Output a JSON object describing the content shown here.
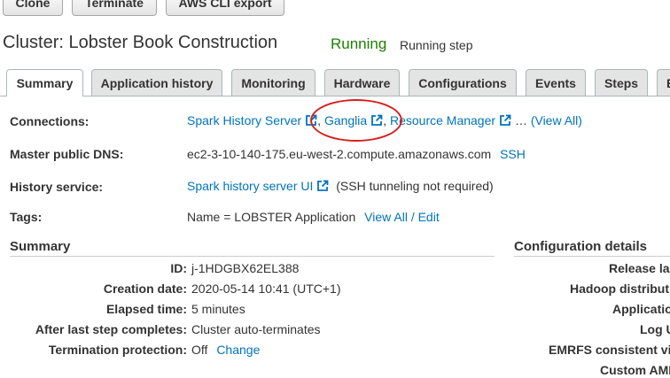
{
  "toolbar": {
    "clone": "Clone",
    "terminate": "Terminate",
    "aws_cli_export": "AWS CLI export"
  },
  "header": {
    "title": "Cluster: Lobster Book Construction",
    "status": "Running",
    "status_detail": "Running step"
  },
  "tabs": [
    {
      "label": "Summary"
    },
    {
      "label": "Application history"
    },
    {
      "label": "Monitoring"
    },
    {
      "label": "Hardware"
    },
    {
      "label": "Configurations"
    },
    {
      "label": "Events"
    },
    {
      "label": "Steps"
    },
    {
      "label": "B"
    }
  ],
  "connections": {
    "label": "Connections:",
    "spark_history": "Spark History Server",
    "ganglia": "Ganglia",
    "resource_manager": "Resource Manager",
    "ellipsis": "…",
    "view_all": "(View All)"
  },
  "master_dns": {
    "label": "Master public DNS:",
    "value": "ec2-3-10-140-175.eu-west-2.compute.amazonaws.com",
    "ssh": "SSH"
  },
  "history_service": {
    "label": "History service:",
    "link": "Spark history server UI",
    "note": "(SSH tunneling not required)"
  },
  "tags": {
    "label": "Tags:",
    "value": "Name = LOBSTER Application",
    "edit": "View All / Edit"
  },
  "summary": {
    "heading": "Summary",
    "rows": [
      {
        "label": "ID:",
        "value": "j-1HDGBX62EL388"
      },
      {
        "label": "Creation date:",
        "value": "2020-05-14 10:41 (UTC+1)"
      },
      {
        "label": "Elapsed time:",
        "value": "5 minutes"
      },
      {
        "label": "After last step completes:",
        "value": "Cluster auto-terminates"
      },
      {
        "label": "Termination protection:",
        "value": "Off",
        "action": "Change"
      }
    ]
  },
  "config": {
    "heading": "Configuration details",
    "rows": [
      {
        "label": "Release la"
      },
      {
        "label": "Hadoop distribut"
      },
      {
        "label": "Applicatio"
      },
      {
        "label": "Log U"
      },
      {
        "label": "EMRFS consistent vi"
      },
      {
        "label": "Custom AMI"
      }
    ]
  },
  "colors": {
    "link": "#0073bb",
    "running": "#1d8102",
    "annotation": "#d62020"
  }
}
